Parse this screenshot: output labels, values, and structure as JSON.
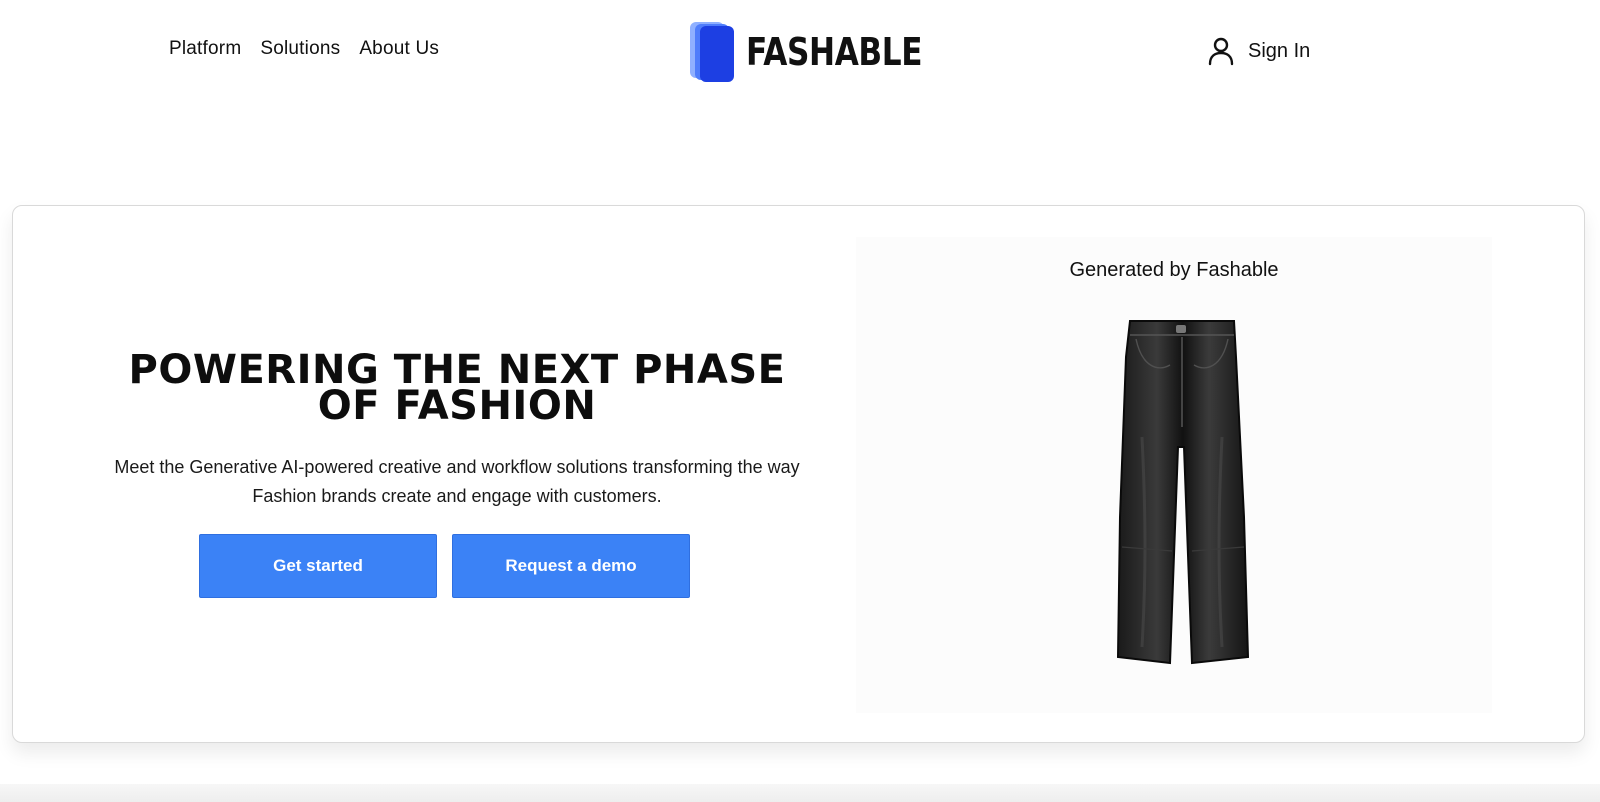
{
  "header": {
    "nav": [
      {
        "label": "Platform"
      },
      {
        "label": "Solutions"
      },
      {
        "label": "About Us"
      }
    ],
    "logo_text": "FASHABLE",
    "signin_label": "Sign In",
    "icons": {
      "signin": "user-icon"
    }
  },
  "hero": {
    "title": "POWERING THE NEXT PHASE OF FASHION",
    "subtitle": "Meet the Generative AI-powered creative and workflow solutions transforming the way Fashion brands create and engage with customers.",
    "buttons": {
      "get_started": "Get started",
      "request_demo": "Request a demo"
    }
  },
  "product": {
    "caption": "Generated by Fashable"
  },
  "colors": {
    "primary_button": "#3b82f6",
    "logo_blue": "#1d3fe3",
    "text": "#111111"
  }
}
